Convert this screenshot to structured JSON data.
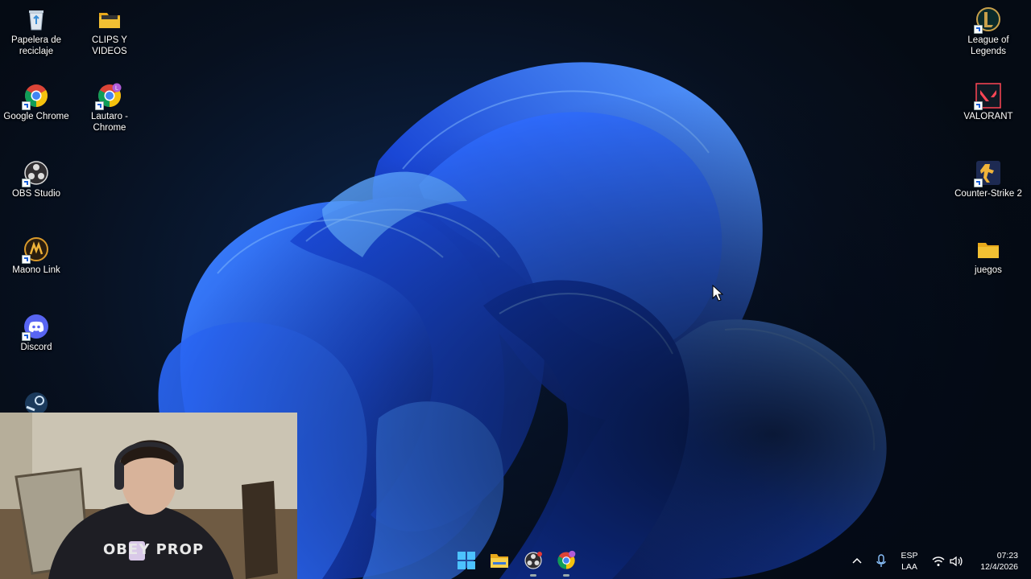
{
  "desktop": {
    "icons_left": [
      {
        "label": "Papelera de reciclaje",
        "icon": "recycle-bin-icon"
      },
      {
        "label": "CLIPS Y VIDEOS",
        "icon": "folder-icon"
      },
      {
        "label": "Google Chrome",
        "icon": "chrome-icon"
      },
      {
        "label": "Lautaro - Chrome",
        "icon": "chrome-profile-icon"
      },
      {
        "label": "OBS Studio",
        "icon": "obs-icon"
      },
      {
        "label": "Maono Link",
        "icon": "maono-link-icon"
      },
      {
        "label": "Discord",
        "icon": "discord-icon"
      }
    ],
    "icons_right": [
      {
        "label": "League of Legends",
        "icon": "league-of-legends-icon"
      },
      {
        "label": "VALORANT",
        "icon": "valorant-icon"
      },
      {
        "label": "Counter-Strike 2",
        "icon": "counter-strike-icon"
      },
      {
        "label": "juegos",
        "icon": "folder-icon"
      }
    ],
    "webcam_shirt_text": "OBEY PROP"
  },
  "taskbar": {
    "items": [
      "start-icon",
      "file-explorer-icon",
      "obs-icon",
      "chrome-profile-icon"
    ],
    "tray": {
      "language_line1": "ESP",
      "language_line2": "LAA",
      "time": "07:23",
      "date": "12/4/2026"
    }
  },
  "colors": {
    "wallpaper_blue": "#1f5cf0",
    "wallpaper_dark": "#07101c",
    "folder_yellow": "#f2c033"
  }
}
